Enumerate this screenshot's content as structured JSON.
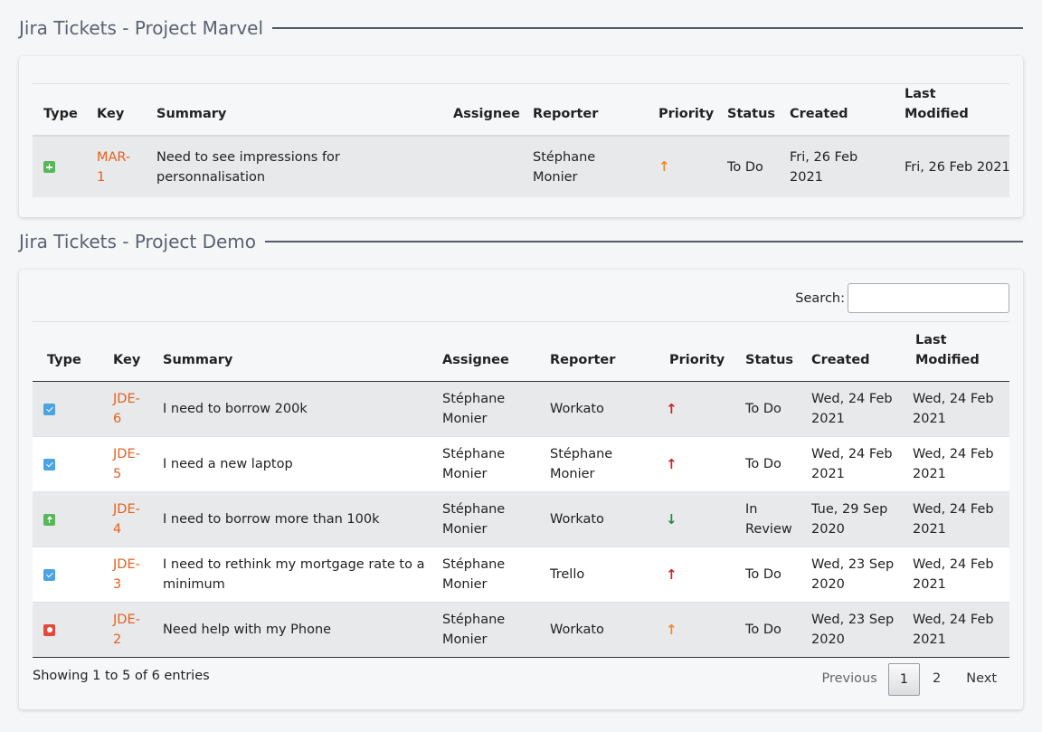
{
  "section1": {
    "title": "Jira Tickets - Project Marvel",
    "columns": [
      "Type",
      "Key",
      "Summary",
      "Assignee",
      "Reporter",
      "Priority",
      "Status",
      "Created",
      "Last Modified"
    ],
    "rows": [
      {
        "type_icon": "new-feature-icon",
        "key": "MAR-1",
        "summary": "Need to see impressions for personnalisation",
        "assignee": "",
        "reporter": "Stéphane Monier",
        "priority_icon": "medium-priority-arrow-up-icon",
        "status": "To Do",
        "created": "Fri, 26 Feb 2021",
        "modified": "Fri, 26 Feb 2021"
      }
    ]
  },
  "section2": {
    "title": "Jira Tickets - Project Demo",
    "search_label": "Search:",
    "search_value": "",
    "columns": [
      "Type",
      "Key",
      "Summary",
      "Assignee",
      "Reporter",
      "Priority",
      "Status",
      "Created",
      "Last Modified"
    ],
    "rows": [
      {
        "type_icon": "task-icon",
        "key": "JDE-6",
        "summary": "I need to borrow 200k",
        "assignee": "Stéphane Monier",
        "reporter": "Workato",
        "priority_icon": "high-priority-arrow-up-icon",
        "status": "To Do",
        "created": "Wed, 24 Feb 2021",
        "modified": "Wed, 24 Feb 2021"
      },
      {
        "type_icon": "task-icon",
        "key": "JDE-5",
        "summary": "I need a new laptop",
        "assignee": "Stéphane Monier",
        "reporter": "Stéphane Monier",
        "priority_icon": "high-priority-arrow-up-icon",
        "status": "To Do",
        "created": "Wed, 24 Feb 2021",
        "modified": "Wed, 24 Feb 2021"
      },
      {
        "type_icon": "improvement-icon",
        "key": "JDE-4",
        "summary": "I need to borrow more than 100k",
        "assignee": "Stéphane Monier",
        "reporter": "Workato",
        "priority_icon": "low-priority-arrow-down-icon",
        "status": "In Review",
        "created": "Tue, 29 Sep 2020",
        "modified": "Wed, 24 Feb 2021"
      },
      {
        "type_icon": "task-icon",
        "key": "JDE-3",
        "summary": "I need to rethink my mortgage rate to a minimum",
        "assignee": "Stéphane Monier",
        "reporter": "Trello",
        "priority_icon": "high-priority-arrow-up-icon",
        "status": "To Do",
        "created": "Wed, 23 Sep 2020",
        "modified": "Wed, 24 Feb 2021"
      },
      {
        "type_icon": "bug-icon",
        "key": "JDE-2",
        "summary": "Need help with my Phone",
        "assignee": "Stéphane Monier",
        "reporter": "Workato",
        "priority_icon": "medium-priority-arrow-up-icon",
        "status": "To Do",
        "created": "Wed, 23 Sep 2020",
        "modified": "Wed, 24 Feb 2021"
      }
    ],
    "footer": {
      "showing": "Showing 1 to 5 of 6 entries",
      "previous": "Previous",
      "current_page": "1",
      "next_page": "2",
      "next": "Next"
    }
  },
  "colors": {
    "key_link": "#e4601f",
    "priority_high": "#d02626",
    "priority_medium": "#f0882d",
    "priority_low": "#2a8a3e"
  }
}
